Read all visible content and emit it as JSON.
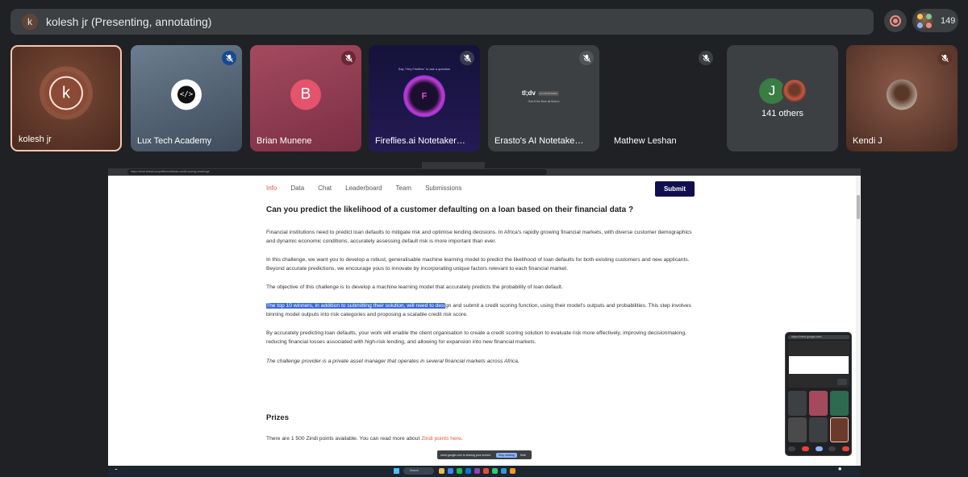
{
  "presenter": {
    "initial": "k",
    "label": "kolesh jr (Presenting, annotating)"
  },
  "participants_count": "149",
  "participants": [
    {
      "name": "kolesh jr",
      "initial": "k"
    },
    {
      "name": "Lux Tech Academy"
    },
    {
      "name": "Brian Munene",
      "initial": "B"
    },
    {
      "name": "Fireflies.ai Notetaker R..."
    },
    {
      "name": "Erasto's AI Notetaker (tl..."
    },
    {
      "name": "Mathew Leshan"
    },
    {
      "name": "141 others",
      "initial": "J"
    },
    {
      "name": "Kendi J"
    }
  ],
  "tile_texts": {
    "fireflies_hint": "Say \"Hey Fireflies\" to ask a question",
    "tldv_logo": "tl;dv",
    "tldv_badge": "AI NOTETAKER",
    "tldv_sub": "Get it for free at tldv.io"
  },
  "browser": {
    "url": "https://zindi.africa/competitions/african-credit-scoring-challenge"
  },
  "page": {
    "nav": [
      "Info",
      "Data",
      "Chat",
      "Leaderboard",
      "Team",
      "Submissions"
    ],
    "submit_label": "Submit",
    "question": "Can you predict the likelihood of a customer defaulting on a loan based on their financial data ?",
    "p1": "Financial institutions need to predict loan defaults to mitigate risk and optimise lending decisions. In Africa's rapidly growing financial markets, with diverse customer demographics and dynamic economic conditions, accurately assessing default risk is more important than ever.",
    "p2": "In this challenge, we want you to develop a robust, generalisable machine learning model to predict the likelihood of loan defaults for both existing customers and new applicants. Beyond accurate predictions, we encourage yous to innovate by incorporating unique factors relevant to each financial market.",
    "p3": "The objective of this challenge is to develop a machine learning model that accurately predicts the probability of loan default.",
    "p4_highlight": "The top 10 winners, in addition to submitting their solution, will need to desi",
    "p4_rest": "gn and submit a credit scoring function, using their model's outputs and probabilities. This step involves binning model outputs into risk categories and proposing a scalable credit risk score.",
    "p5": "By accurately predicting loan defaults, your work will enable the client organisation to create a credit scoring solution to evaluate risk more effectively, improving decisionmaking, reducing financial losses associated with high-risk lending, and allowing for expansion into new financial markets.",
    "p6": "The challenge provider is a private asset manager that operates in several financial markets across Africa.",
    "prizes_title": "Prizes",
    "prizes_text": "There are 1 500 Zindi points available. You can read more about ",
    "prizes_link": "Zindi points here",
    "prizes_end": "."
  },
  "share_bar": {
    "text": "meet.google.com is sharing your screen.",
    "stop": "Stop sharing",
    "hide": "Hide"
  },
  "taskbar": {
    "search": "Search"
  },
  "pip": {
    "url": "https://meet.google.com"
  },
  "colors": {
    "accent": "#e0583b",
    "submit_bg": "#0f0f4f",
    "highlight": "#3a6bd6",
    "meet_bg": "#202124"
  }
}
